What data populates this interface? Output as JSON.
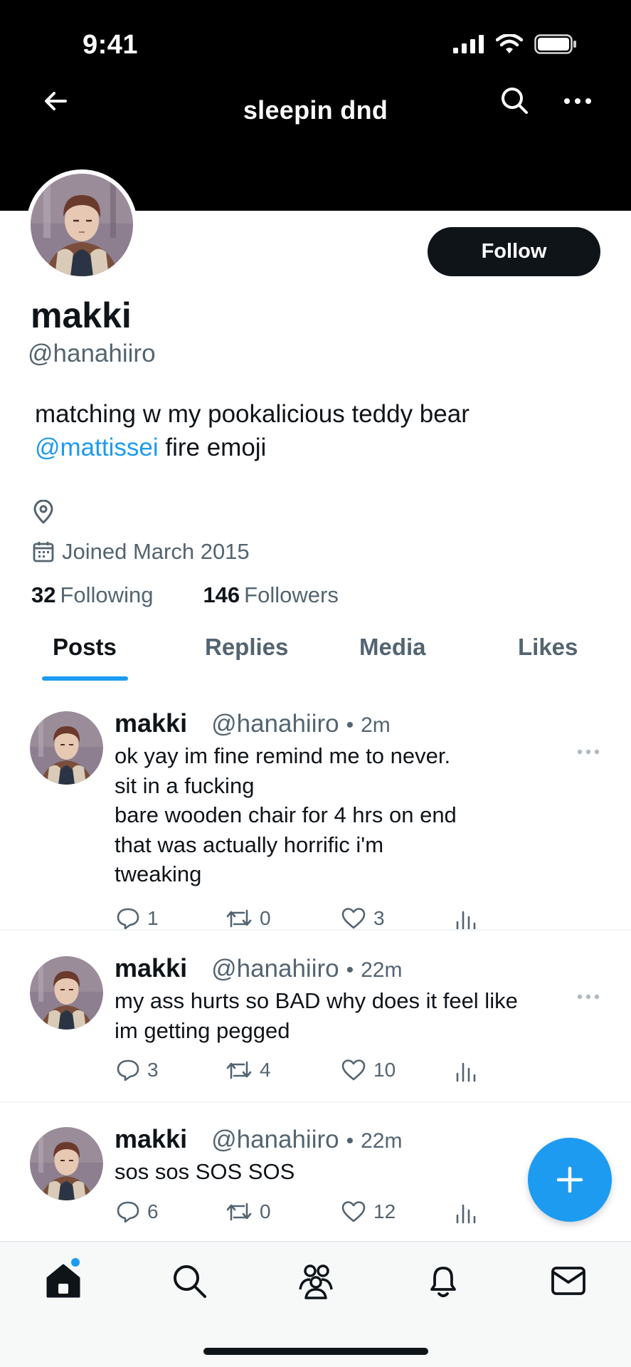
{
  "status_bar": {
    "time": "9:41"
  },
  "header": {
    "title": "sleepin dnd",
    "icons": [
      "back-arrow-icon",
      "search-icon",
      "more-icon"
    ]
  },
  "profile": {
    "display_name": "makki",
    "handle": "@hanahiiro",
    "follow_label": "Follow",
    "bio_text": "matching w my pookalicious teddy bear",
    "bio_mention": "@mattissei",
    "bio_suffix": " fire emoji",
    "joined": "Joined March 2015",
    "following_count": "32",
    "following_label": "Following",
    "followers_count": "146",
    "followers_label": "Followers"
  },
  "tabs": [
    {
      "label": "Posts",
      "active": true
    },
    {
      "label": "Replies",
      "active": false
    },
    {
      "label": "Media",
      "active": false
    },
    {
      "label": "Likes",
      "active": false
    }
  ],
  "posts": [
    {
      "name": "makki",
      "handle": "@hanahiiro",
      "dot": "•",
      "time": "2m",
      "text": "ok yay im fine remind me to never.\nsit in a fucking\nbare wooden chair for 4 hrs on end\nthat was actually horrific i'm\ntweaking",
      "replies": "1",
      "reposts": "0",
      "likes": "3"
    },
    {
      "name": "makki",
      "handle": "@hanahiiro",
      "dot": "•",
      "time": "22m",
      "text": "my ass hurts so BAD why does it feel like\n im getting pegged",
      "replies": "3",
      "reposts": "4",
      "likes": "10"
    },
    {
      "name": "makki",
      "handle": "@hanahiiro",
      "dot": "•",
      "time": "22m",
      "text": "sos sos SOS SOS",
      "replies": "6",
      "reposts": "0",
      "likes": "12"
    }
  ],
  "bottom_nav": [
    "home-icon",
    "search-icon",
    "communities-icon",
    "notifications-icon",
    "messages-icon"
  ],
  "colors": {
    "accent": "#1d9bf0",
    "text": "#0f1419",
    "muted": "#536471",
    "banner": "#000000"
  }
}
